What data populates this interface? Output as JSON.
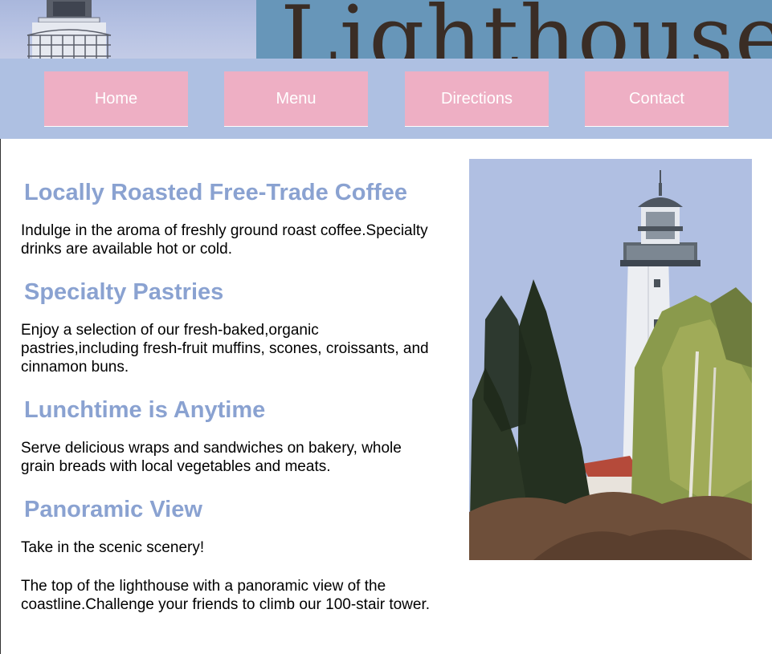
{
  "header": {
    "logo_text": "Lighthouse"
  },
  "nav": {
    "items": [
      {
        "label": "Home"
      },
      {
        "label": "Menu"
      },
      {
        "label": "Directions"
      },
      {
        "label": "Contact"
      }
    ]
  },
  "sections": [
    {
      "heading": "Locally Roasted Free-Trade Coffee",
      "paragraphs": [
        "Indulge in the aroma of freshly ground roast coffee.Specialty drinks are available hot or cold."
      ]
    },
    {
      "heading": "Specialty Pastries",
      "paragraphs": [
        "Enjoy a selection of our fresh-baked,organic pastries,including fresh-fruit muffins, scones, croissants, and cinnamon buns."
      ]
    },
    {
      "heading": "Lunchtime is Anytime",
      "paragraphs": [
        "Serve delicious wraps and sandwiches on bakery, whole grain breads with local vegetables and meats."
      ]
    },
    {
      "heading": "Panoramic View",
      "paragraphs": [
        "Take in the scenic scenery!",
        "The top of the lighthouse with a panoramic view of the coastline.Challenge your friends to climb our 100-stair tower."
      ]
    }
  ],
  "colors": {
    "nav_bg": "#aec0e2",
    "nav_button": "#eeafc4",
    "heading": "#8aa2d1",
    "logo_bg": "#6796b9"
  }
}
